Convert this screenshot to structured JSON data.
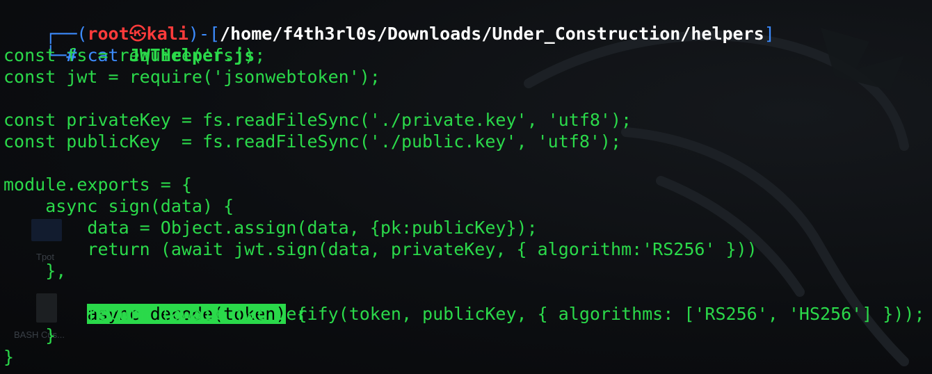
{
  "prompt": {
    "line1_prefix": "┌──(",
    "user": "root",
    "skull": "㉿",
    "host": "kali",
    "line1_mid": ")-[",
    "path": "/home/f4th3rl0s/Downloads/Under_Construction/helpers",
    "line1_end": "]",
    "line2_prefix": "└─",
    "hash": "#",
    "command": "cat",
    "argument": "JWTHelper.js"
  },
  "code_lines": [
    "const fs = require('fs');",
    "const jwt = require('jsonwebtoken');",
    "",
    "const privateKey = fs.readFileSync('./private.key', 'utf8');",
    "const publicKey  = fs.readFileSync('./public.key', 'utf8');",
    "",
    "module.exports = {",
    "    async sign(data) {",
    "        data = Object.assign(data, {pk:publicKey});",
    "        return (await jwt.sign(data, privateKey, { algorithm:'RS256' }))",
    "    },",
    "    async decode(token) {",
    "        return (await jwt.verify(token, publicKey, { algorithms: ['RS256', 'HS256'] }));",
    "    }",
    "}"
  ],
  "highlight": {
    "indent": "    ",
    "selected": "async decode(token)",
    "rest": " {"
  },
  "desktop": {
    "icon_label_1": "Tpot",
    "icon_label_2": "BASH Cus..."
  },
  "colors": {
    "text_green": "#2bd94a",
    "prompt_blue": "#3d8cff",
    "prompt_red": "#ff3b3b",
    "path_white": "#ffffff",
    "highlight_bg": "#2ad94a",
    "background": "#0b0d10"
  }
}
